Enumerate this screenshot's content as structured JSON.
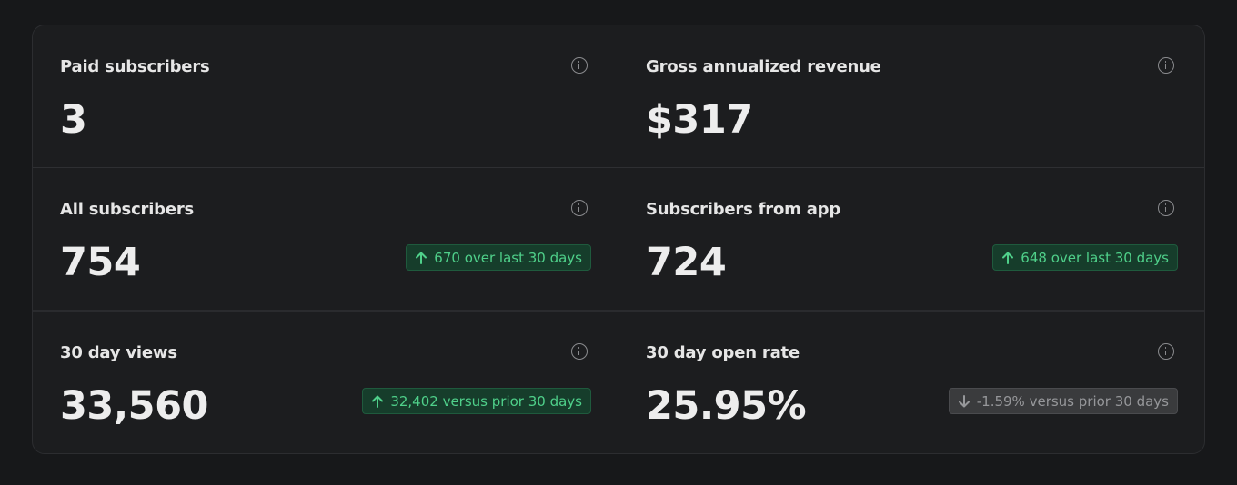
{
  "stats": [
    {
      "label": "Paid subscribers",
      "value": "3",
      "badge": null
    },
    {
      "label": "Gross annualized revenue",
      "value": "$317",
      "badge": null
    },
    {
      "label": "All subscribers",
      "value": "754",
      "badge": {
        "text": "670 over last 30 days",
        "direction": "up"
      }
    },
    {
      "label": "Subscribers from app",
      "value": "724",
      "badge": {
        "text": "648 over last 30 days",
        "direction": "up"
      }
    },
    {
      "label": "30 day views",
      "value": "33,560",
      "badge": {
        "text": "32,402 versus prior 30 days",
        "direction": "up"
      }
    },
    {
      "label": "30 day open rate",
      "value": "25.95%",
      "badge": {
        "text": "-1.59% versus prior 30 days",
        "direction": "down"
      }
    }
  ],
  "colors": {
    "positive": "#4fd08a",
    "neutral": "#96979a"
  },
  "icons": {
    "info": "info-circle-icon",
    "up": "arrow-up-icon",
    "down": "arrow-down-icon"
  }
}
